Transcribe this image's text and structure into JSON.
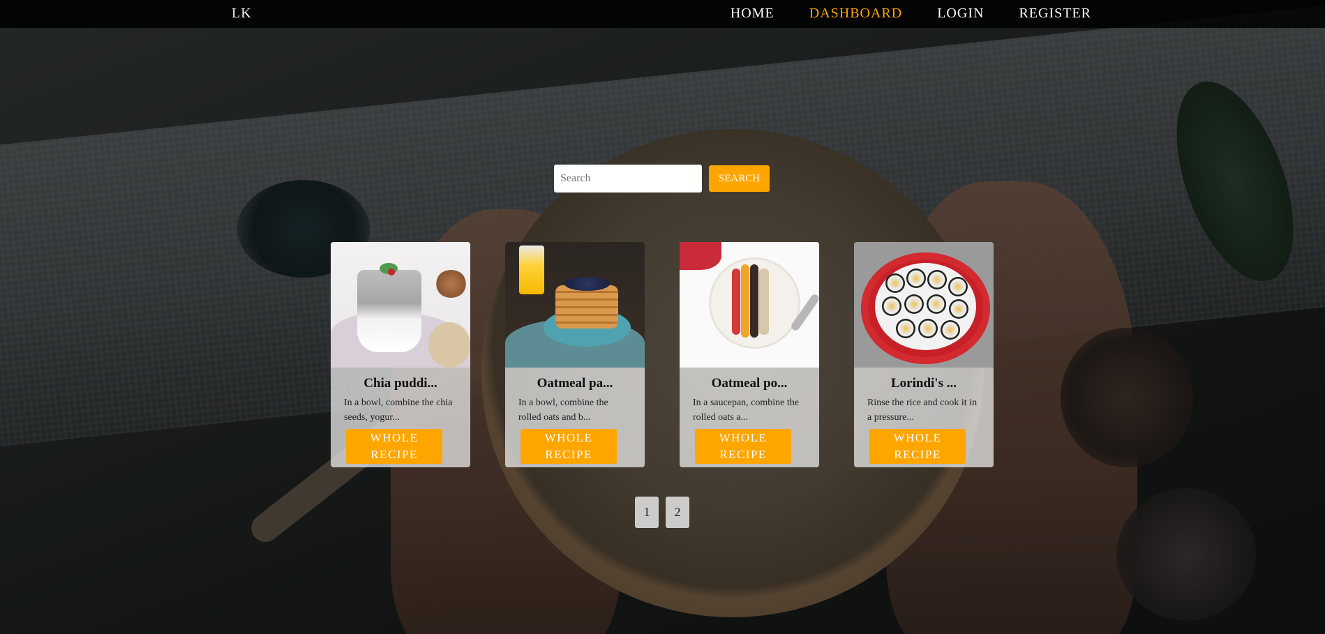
{
  "nav": {
    "logo": "LK",
    "items": [
      {
        "label": "HOME",
        "active": false
      },
      {
        "label": "DASHBOARD",
        "active": true
      },
      {
        "label": "LOGIN",
        "active": false
      },
      {
        "label": "REGISTER",
        "active": false
      }
    ]
  },
  "search": {
    "placeholder": "Search",
    "value": "",
    "button_label": "SEARCH"
  },
  "recipes": [
    {
      "title": "Chia puddi...",
      "description": "In a bowl, combine the chia seeds, yogur...",
      "button_label": "WHOLE RECIPE",
      "image": "chia-pudding-photo"
    },
    {
      "title": "Oatmeal pa...",
      "description": "In a bowl, combine the rolled oats and b...",
      "button_label": "WHOLE RECIPE",
      "image": "oatmeal-pancakes-photo"
    },
    {
      "title": "Oatmeal po...",
      "description": "In a saucepan, combine the rolled oats a...",
      "button_label": "WHOLE RECIPE",
      "image": "oatmeal-porridge-photo"
    },
    {
      "title": "Lorindi's ...",
      "description": "Rinse the rice and cook it in a pressure...",
      "button_label": "WHOLE RECIPE",
      "image": "sushi-photo"
    }
  ],
  "pagination": {
    "pages": [
      "1",
      "2"
    ]
  },
  "colors": {
    "accent": "#ffa500",
    "nav_background": "#000000"
  }
}
